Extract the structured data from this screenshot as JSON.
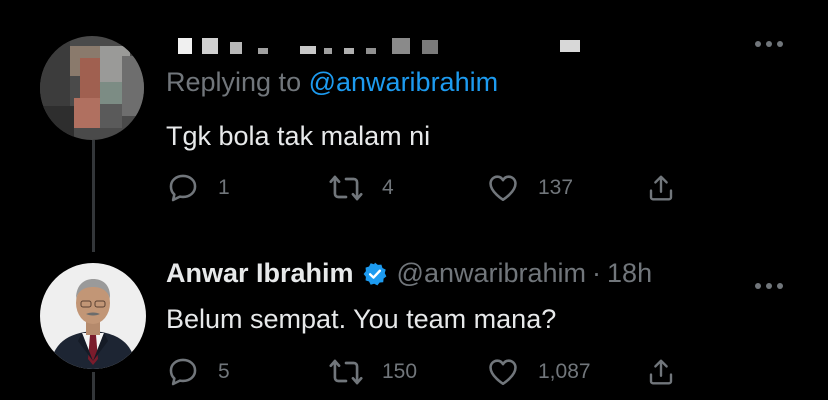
{
  "reply_tweet": {
    "reply_label": "Replying to",
    "reply_handle": "@anwaribrahim",
    "text": "Tgk bola tak malam ni",
    "more_icon": "more-horizontal-icon",
    "stats": {
      "replies": "1",
      "retweets": "4",
      "likes": "137"
    }
  },
  "main_tweet": {
    "name": "Anwar Ibrahim",
    "handle": "@anwaribrahim",
    "separator": "·",
    "time": "18h",
    "text": "Belum sempat. You team mana?",
    "more_icon": "more-horizontal-icon",
    "verified_icon": "verified-badge-icon",
    "stats": {
      "replies": "5",
      "retweets": "150",
      "likes": "1,087"
    }
  },
  "colors": {
    "background": "#000000",
    "text": "#e7e9ea",
    "muted": "#71767b",
    "accent": "#1d9bf0"
  }
}
